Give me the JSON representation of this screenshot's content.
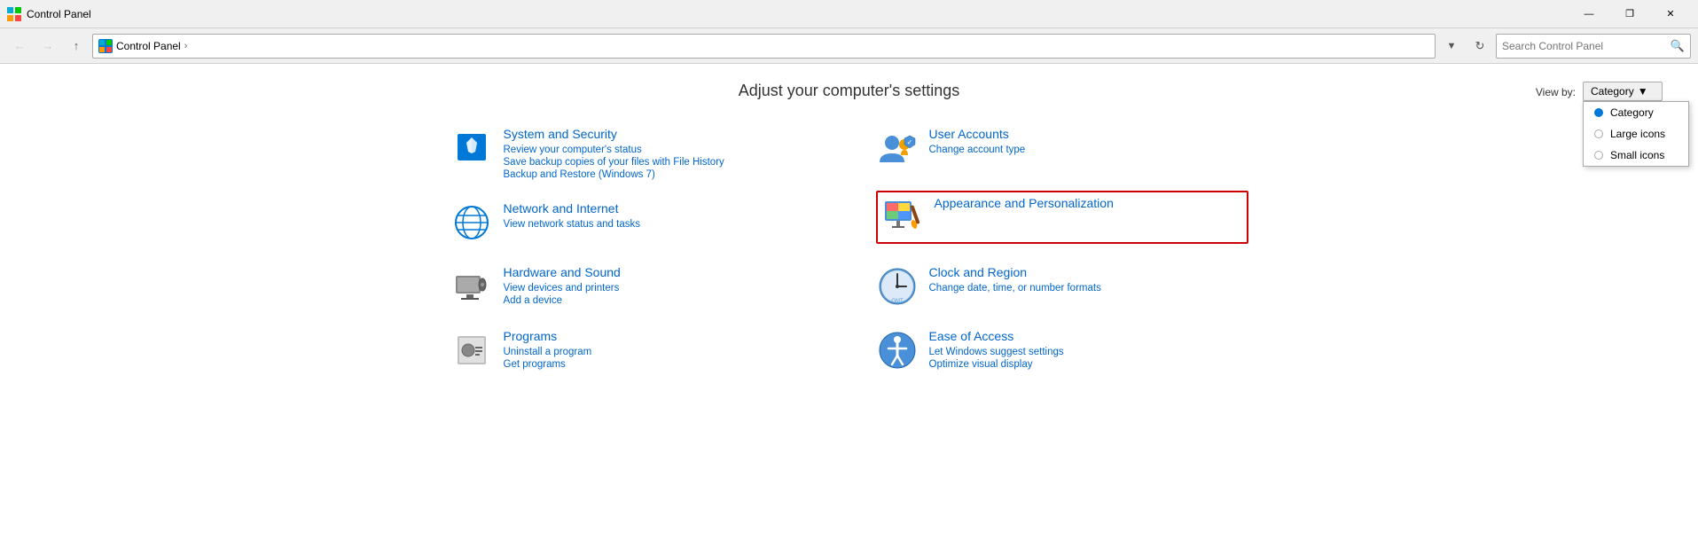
{
  "titlebar": {
    "title": "Control Panel",
    "icon_label": "CP",
    "minimize_label": "—",
    "maximize_label": "❐",
    "close_label": "✕"
  },
  "navbar": {
    "back_tooltip": "Back",
    "forward_tooltip": "Forward",
    "up_tooltip": "Up",
    "address_icon": "CP",
    "address_path": "Control Panel",
    "address_separator": "›",
    "search_placeholder": "Search Control Panel"
  },
  "main": {
    "page_title": "Adjust your computer's settings",
    "view_by_label": "View by:",
    "view_by_selected": "Category",
    "view_by_options": [
      "Category",
      "Large icons",
      "Small icons"
    ]
  },
  "categories": {
    "left_column": [
      {
        "id": "system-security",
        "title": "System and Security",
        "sub_links": [
          "Review your computer's status",
          "Save backup copies of your files with File History",
          "Backup and Restore (Windows 7)"
        ]
      },
      {
        "id": "network-internet",
        "title": "Network and Internet",
        "sub_links": [
          "View network status and tasks"
        ]
      },
      {
        "id": "hardware-sound",
        "title": "Hardware and Sound",
        "sub_links": [
          "View devices and printers",
          "Add a device"
        ]
      },
      {
        "id": "programs",
        "title": "Programs",
        "sub_links": [
          "Uninstall a program",
          "Get programs"
        ]
      }
    ],
    "right_column": [
      {
        "id": "user-accounts",
        "title": "User Accounts",
        "sub_links": [
          "Change account type"
        ],
        "highlighted": false
      },
      {
        "id": "appearance-personalization",
        "title": "Appearance and Personalization",
        "sub_links": [],
        "highlighted": true
      },
      {
        "id": "clock-region",
        "title": "Clock and Region",
        "sub_links": [
          "Change date, time, or number formats"
        ]
      },
      {
        "id": "ease-access",
        "title": "Ease of Access",
        "sub_links": [
          "Let Windows suggest settings",
          "Optimize visual display"
        ]
      }
    ]
  }
}
